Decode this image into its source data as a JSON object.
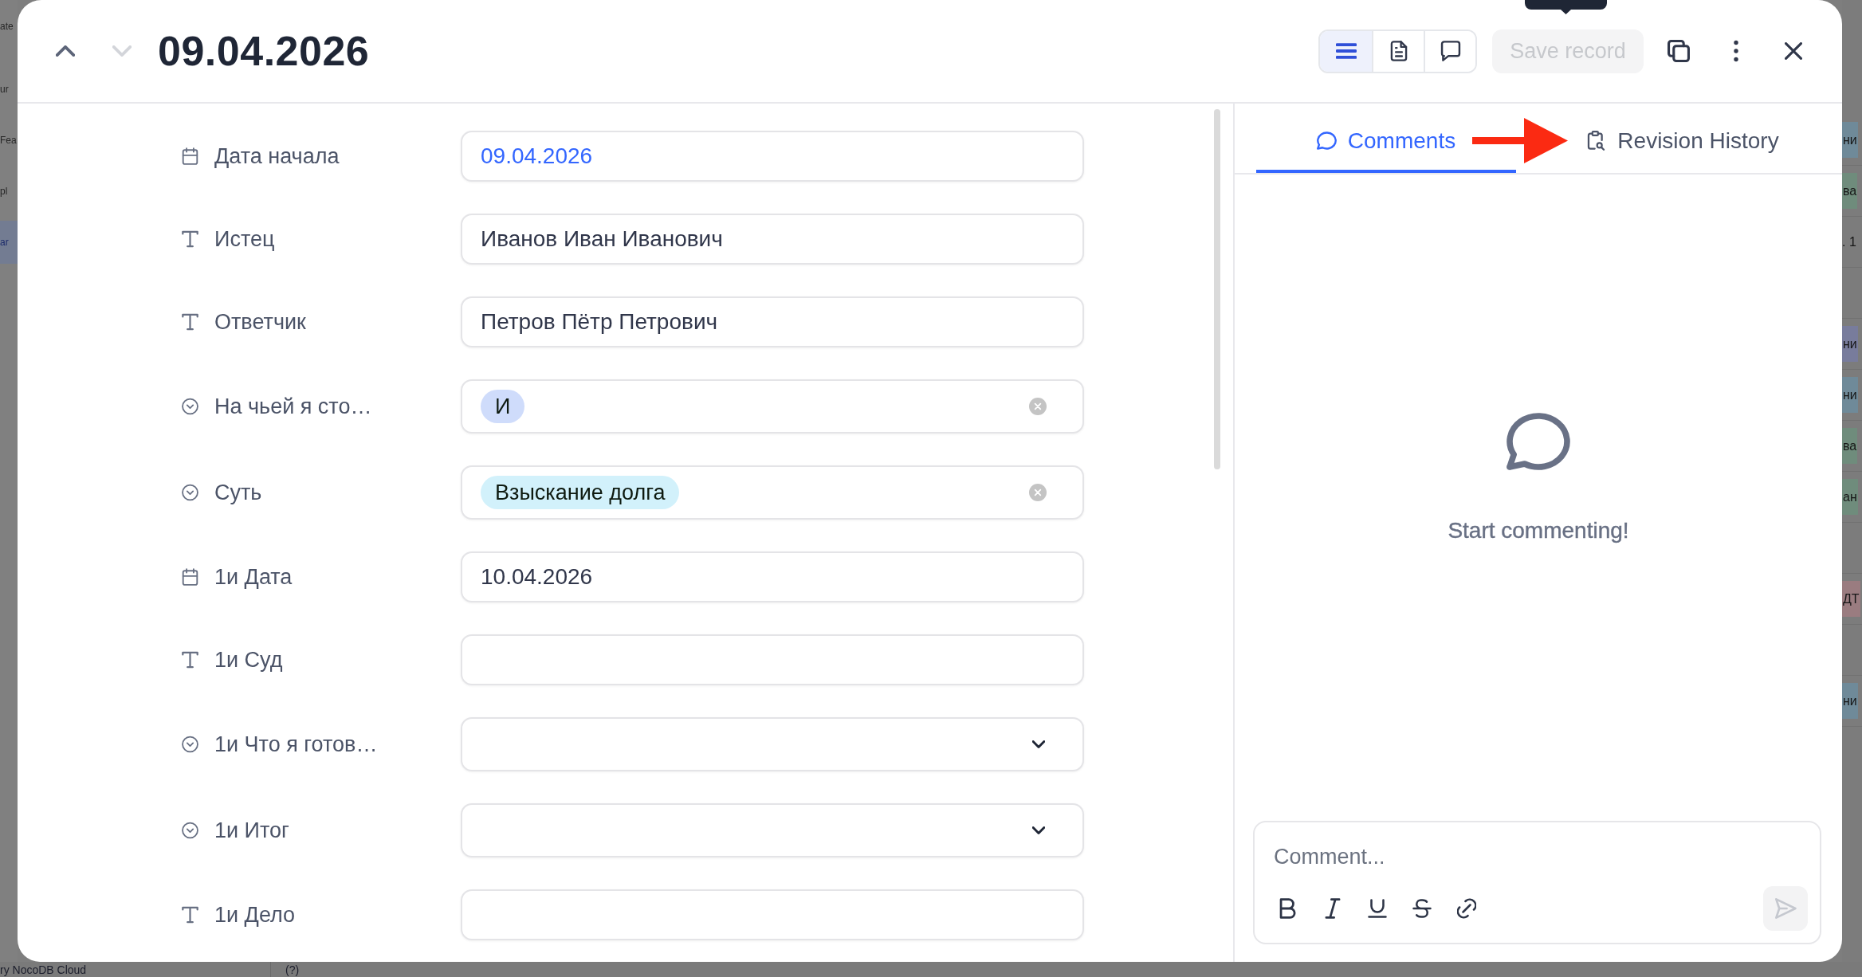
{
  "backdrop": {
    "sidebar": {
      "heading": "ate",
      "items": [
        {
          "label": "ur",
          "selected": false
        },
        {
          "label": "Fea",
          "selected": false
        },
        {
          "label": "pl",
          "selected": false
        },
        {
          "label": "ar",
          "selected": true
        }
      ]
    },
    "grid_rows": [
      {
        "text": "ни",
        "color": "#6f8a99"
      },
      {
        "text": "ва",
        "color": "#6f8c7c"
      },
      {
        "text": ". 1"
      },
      {},
      {
        "text": "ни",
        "color": "#787c9c"
      },
      {
        "text": "ни",
        "color": "#6f8a99"
      },
      {
        "text": "ва",
        "color": "#6f8c7c"
      },
      {
        "text": "ан",
        "color": "#6f8c7c"
      },
      {},
      {
        "text": "ДТ",
        "color": "#9a7c80"
      },
      {},
      {
        "text": "ни",
        "color": "#6f8a99"
      }
    ],
    "footer": {
      "label": "ry NocoDB Cloud",
      "help": "(?)"
    }
  },
  "header": {
    "nav": [
      {
        "kind": "previous",
        "disabled": false
      },
      {
        "kind": "next",
        "disabled": true
      }
    ],
    "title": "09.04.2026",
    "views": [
      {
        "kind": "fields",
        "selected": true
      },
      {
        "kind": "files",
        "selected": false
      },
      {
        "kind": "comments",
        "selected": false
      }
    ],
    "save": {
      "label": "Save record",
      "disabled": true
    },
    "actions": [
      {
        "kind": "duplicate"
      },
      {
        "kind": "more"
      },
      {
        "kind": "close"
      }
    ],
    "tooltip_open": true
  },
  "fields": [
    {
      "kind": "date",
      "label": "Дата начала",
      "value": "09.04.2026",
      "active": true
    },
    {
      "kind": "text",
      "label": "Истец",
      "value": "Иванов Иван Иванович",
      "active": false
    },
    {
      "kind": "text",
      "label": "Ответчик",
      "value": "Петров Пётр Петрович",
      "active": false
    },
    {
      "kind": "select",
      "label": "На чьей я сто…",
      "options": [
        {
          "label": "И",
          "color": "#cfdcfb"
        }
      ]
    },
    {
      "kind": "select",
      "label": "Суть",
      "options": [
        {
          "label": "Взыскание долга",
          "color": "#d2f1fb"
        }
      ]
    },
    {
      "kind": "date",
      "label": "1и Дата",
      "value": "10.04.2026",
      "active": false
    },
    {
      "kind": "text",
      "label": "1и Суд"
    },
    {
      "kind": "select",
      "label": "1и Что я готов…"
    },
    {
      "kind": "select",
      "label": "1и Итог"
    },
    {
      "kind": "text",
      "label": "1и Дело"
    }
  ],
  "side_panel": {
    "tabs": [
      {
        "kind": "comments",
        "label": "Comments",
        "selected": true
      },
      {
        "kind": "history",
        "label": "Revision History",
        "selected": false
      }
    ],
    "empty_state": "Start commenting!",
    "composer": {
      "placeholder": "Comment...",
      "tools": [
        {
          "kind": "bold"
        },
        {
          "kind": "italic"
        },
        {
          "kind": "underline"
        },
        {
          "kind": "strikethrough"
        },
        {
          "kind": "link"
        }
      ],
      "send_disabled": true
    }
  }
}
